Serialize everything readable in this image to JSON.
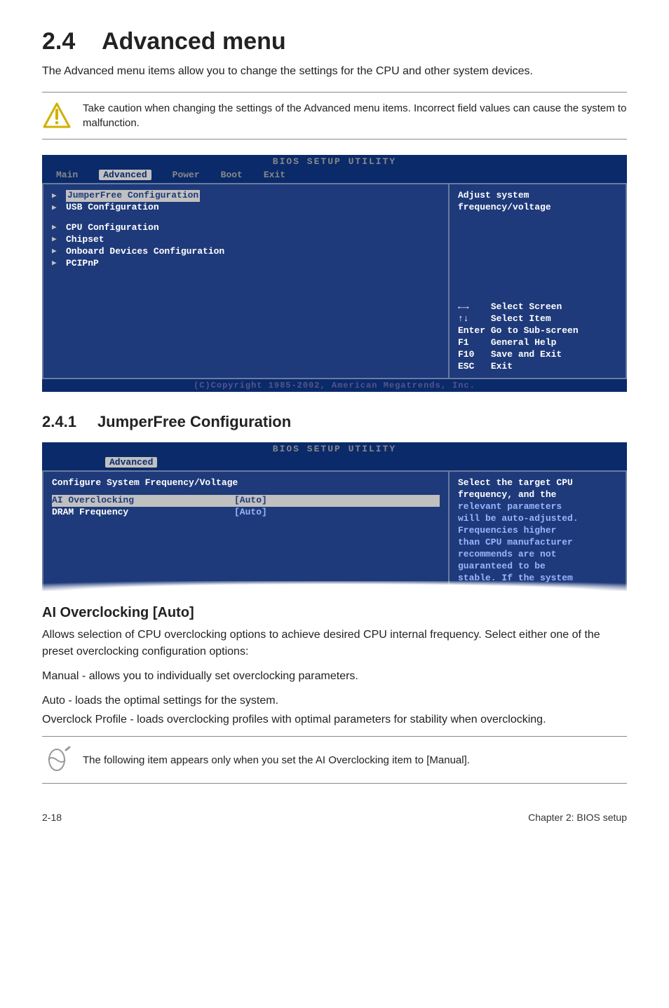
{
  "header": {
    "section_number": "2.4",
    "section_title": "Advanced menu",
    "intro": "The Advanced menu items allow you to change the settings for the CPU and other system devices."
  },
  "caution": {
    "text": "Take caution when changing the settings of the Advanced menu items. Incorrect field values can cause the system to malfunction."
  },
  "bios1": {
    "title": "BIOS SETUP UTILITY",
    "tabs": {
      "main": "Main",
      "advanced": "Advanced",
      "power": "Power",
      "boot": "Boot",
      "exit": "Exit"
    },
    "items": [
      {
        "label": "JumperFree Configuration",
        "selected": true
      },
      {
        "label": "USB Configuration"
      },
      {
        "label": "CPU Configuration",
        "spaced": true
      },
      {
        "label": "Chipset"
      },
      {
        "label": "Onboard Devices Configuration"
      },
      {
        "label": "PCIPnP"
      }
    ],
    "help_line1": "Adjust system",
    "help_line2": "frequency/voltage",
    "nav": {
      "screen": "Select Screen",
      "item": "Select Item",
      "enter": "Go to Sub-screen",
      "f1": "General Help",
      "f10": "Save and Exit",
      "esc": "Exit"
    },
    "footer": "(C)Copyright 1985-2002, American Megatrends, Inc."
  },
  "subsection": {
    "number": "2.4.1",
    "title": "JumperFree Configuration"
  },
  "bios2": {
    "title": "BIOS SETUP UTILITY",
    "tab": "Advanced",
    "header": "Configure System Frequency/Voltage",
    "rows": [
      {
        "name": "AI Overclocking",
        "value": "[Auto]",
        "selected": true
      },
      {
        "name": "DRAM Frequency",
        "value": "[Auto]",
        "blue": true
      }
    ],
    "help": [
      "Select the target CPU",
      "frequency, and the",
      "relevant parameters",
      "will be auto-adjusted.",
      "Frequencies higher",
      "than CPU manufacturer",
      "recommends are not",
      "guaranteed to be",
      "stable. If the system"
    ],
    "help_white_count": 2
  },
  "ai_overclocking": {
    "heading": "AI Overclocking [Auto]",
    "p1": "Allows selection of CPU overclocking options to achieve desired CPU internal frequency. Select either one of the preset overclocking configuration options:",
    "p2": "Manual - allows you to individually set overclocking parameters.",
    "p3": "Auto - loads the optimal settings for the system.",
    "p4": "Overclock Profile - loads overclocking profiles with optimal parameters for stability when overclocking."
  },
  "note": {
    "text": "The following item appears only when you set the AI Overclocking item to [Manual]."
  },
  "footer": {
    "left": "2-18",
    "right": "Chapter 2: BIOS setup"
  }
}
